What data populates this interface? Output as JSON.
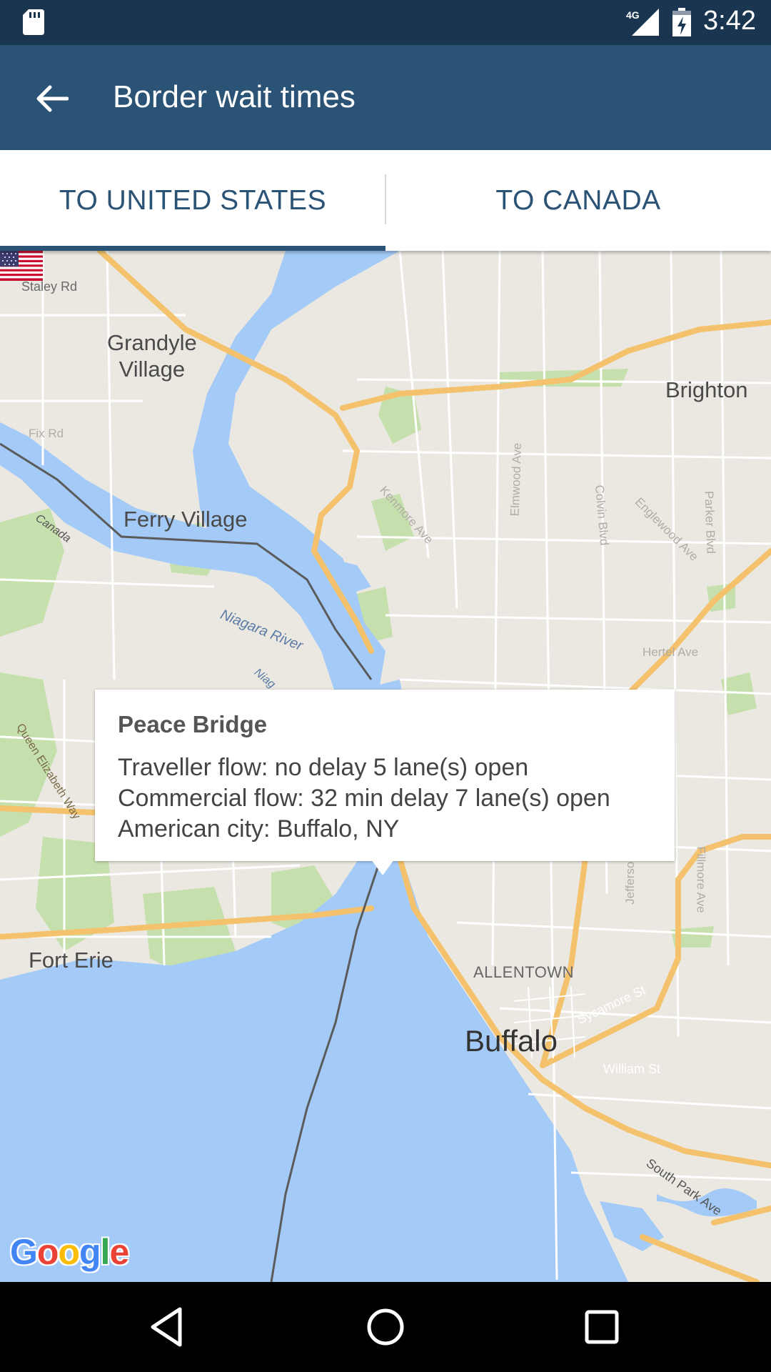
{
  "status_bar": {
    "time": "3:42",
    "network": "4G",
    "icons": [
      "sd-card-icon",
      "signal-icon",
      "battery-icon"
    ]
  },
  "app_bar": {
    "title": "Border wait times",
    "back_icon": "arrow-back-icon"
  },
  "tabs": [
    {
      "label": "TO UNITED STATES",
      "selected": true
    },
    {
      "label": "TO CANADA",
      "selected": false
    }
  ],
  "map": {
    "labels": {
      "staley_rd": "Staley Rd",
      "grandyle_1": "Grandyle",
      "grandyle_2": "Village",
      "fix_rd": "Fix Rd",
      "ferry_village": "Ferry Village",
      "canada": "Canada",
      "niagara_river": "Niagara River",
      "niag": "Niag",
      "kenmore_ave": "Kenmore Ave",
      "elmwood_ave": "Elmwood Ave",
      "colvin_blvd": "Colvin Blvd",
      "englewood_ave": "Englewood Ave",
      "parker_blvd": "Parker Blvd",
      "brighton": "Brighton",
      "hertel_ave": "Hertel Ave",
      "queen_elizabeth_way": "Queen Elizabeth Way",
      "fillmore_ave": "Fillmore Ave",
      "jefferson": "Jefferson",
      "fort_erie": "Fort Erie",
      "allentown": "ALLENTOWN",
      "sycamore_st": "Sycamore St",
      "william_st": "William St",
      "buffalo": "Buffalo",
      "south_park_ave": "South Park Ave"
    },
    "google_logo": [
      "G",
      "o",
      "o",
      "g",
      "l",
      "e"
    ],
    "google_colors": [
      "#4285f4",
      "#ea4335",
      "#fbbc05",
      "#4285f4",
      "#34a853",
      "#ea4335"
    ],
    "marker_icon": "us-flag-icon"
  },
  "info_window": {
    "title": "Peace Bridge",
    "traveller_flow": "Traveller flow: no delay 5 lane(s) open",
    "commercial_flow": "Commercial flow: 32 min delay 7 lane(s) open",
    "american_city": "American city: Buffalo, NY"
  },
  "nav_bar": {
    "buttons": [
      "back-triangle-icon",
      "home-circle-icon",
      "recents-square-icon"
    ]
  },
  "colors": {
    "status_bar": "#1a3550",
    "app_bar": "#2b5375",
    "water": "#a4cbf8",
    "land": "#ebe8e1",
    "highway": "#f6c66a",
    "park": "#c2dea8"
  }
}
